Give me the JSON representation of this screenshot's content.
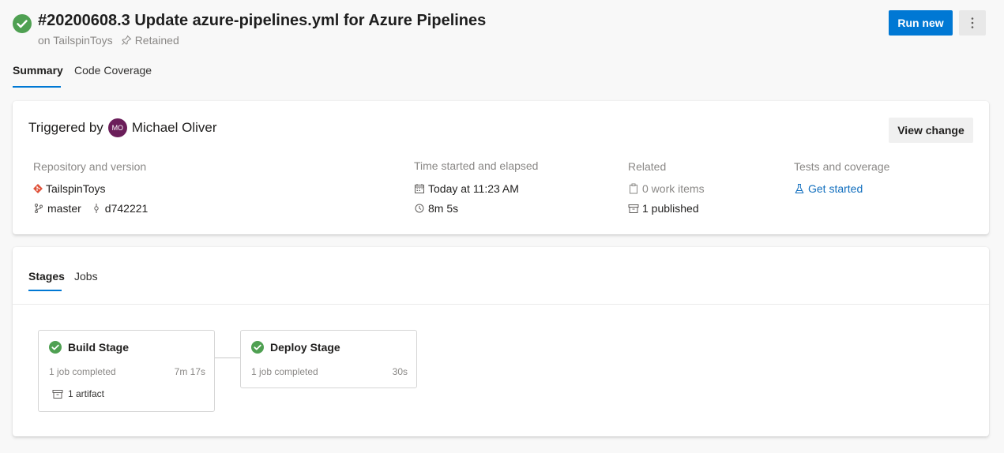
{
  "colors": {
    "accent": "#0078d4",
    "success": "#4fa052",
    "avatar": "#6b1e5a",
    "git": "#e0533b",
    "link": "#106ebe"
  },
  "header": {
    "status_icon": "check-circle-icon",
    "title": "#20200608.3 Update azure-pipelines.yml for Azure Pipelines",
    "subtitle_project": "on TailspinToys",
    "subtitle_retained": "Retained",
    "run_new_label": "Run new",
    "more_icon": "more-vertical-icon"
  },
  "tabs": [
    {
      "label": "Summary",
      "selected": true
    },
    {
      "label": "Code Coverage",
      "selected": false
    }
  ],
  "summary": {
    "triggered_by_label": "Triggered by",
    "user_initials": "MO",
    "user_name": "Michael Oliver",
    "view_change_label": "View change",
    "repository": {
      "label": "Repository and version",
      "repo_name": "TailspinToys",
      "branch": "master",
      "commit": "d742221"
    },
    "time": {
      "label": "Time started and elapsed",
      "started": "Today at 11:23 AM",
      "elapsed": "8m 5s"
    },
    "related": {
      "label": "Related",
      "work_items": "0 work items",
      "published": "1 published"
    },
    "tests": {
      "label": "Tests and coverage",
      "link": "Get started"
    }
  },
  "stages_card": {
    "tabs": [
      {
        "label": "Stages",
        "selected": true
      },
      {
        "label": "Jobs",
        "selected": false
      }
    ],
    "stages": [
      {
        "name": "Build Stage",
        "jobs": "1 job completed",
        "duration": "7m 17s",
        "artifact": "1 artifact"
      },
      {
        "name": "Deploy Stage",
        "jobs": "1 job completed",
        "duration": "30s"
      }
    ]
  }
}
